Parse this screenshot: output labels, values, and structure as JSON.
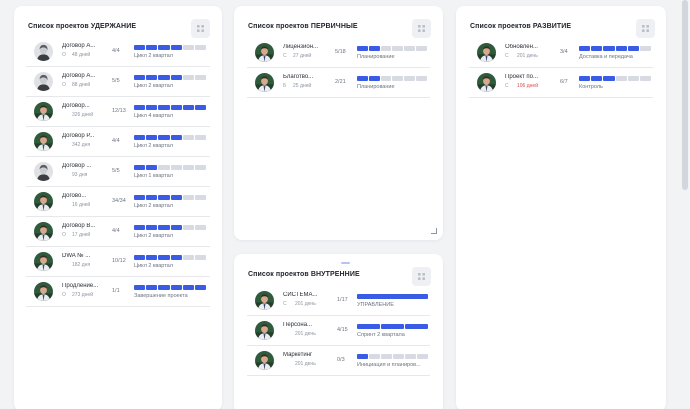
{
  "colors": {
    "accent": "#3a5ce4",
    "segment_off": "#d7dae2",
    "overdue": "#e24a4a"
  },
  "icons": {
    "grip": "grip-icon",
    "avatar": "avatar-photo"
  },
  "cards": [
    {
      "title": "Список проектов УДЕРЖАНИЕ",
      "rows": [
        {
          "name": "Договор А...",
          "code": "О",
          "days": "48 дней",
          "count": "4/4",
          "stage": "Цикл 2 квартал",
          "segments": 6,
          "filled": 4,
          "avatar": "b"
        },
        {
          "name": "Договор А...",
          "code": "О",
          "days": "88 дней",
          "count": "5/5",
          "stage": "Цикл 2 квартал",
          "segments": 6,
          "filled": 4,
          "avatar": "b"
        },
        {
          "name": "Договор...",
          "code": "",
          "days": "326 дней",
          "count": "12/13",
          "stage": "Цикл 4 квартал",
          "segments": 6,
          "filled": 6,
          "avatar": "a"
        },
        {
          "name": "Договор Р...",
          "code": "",
          "days": "342 дня",
          "count": "4/4",
          "stage": "Цикл 2 квартал",
          "segments": 6,
          "filled": 4,
          "avatar": "a"
        },
        {
          "name": "Договор ...",
          "code": "",
          "days": "93 дня",
          "count": "5/5",
          "stage": "Цикл 1 квартал",
          "segments": 6,
          "filled": 2,
          "avatar": "b"
        },
        {
          "name": "Догово...",
          "code": "",
          "days": "16 дней",
          "count": "34/34",
          "stage": "Цикл 2 квартал",
          "segments": 6,
          "filled": 4,
          "avatar": "a"
        },
        {
          "name": "Договор В...",
          "code": "О",
          "days": "17 дней",
          "count": "4/4",
          "stage": "Цикл 2 квартал",
          "segments": 6,
          "filled": 4,
          "avatar": "a"
        },
        {
          "name": "DWA № ...",
          "code": "",
          "days": "182 дня",
          "count": "10/12",
          "stage": "Цикл 2 квартал",
          "segments": 6,
          "filled": 4,
          "avatar": "a"
        },
        {
          "name": "Продление...",
          "code": "О",
          "days": "273 дней",
          "count": "1/1",
          "stage": "Завершение проекта",
          "segments": 6,
          "filled": 6,
          "avatar": "a"
        }
      ]
    },
    {
      "title": "Список проектов ПЕРВИЧНЫЕ",
      "rows": [
        {
          "name": "Лицензион...",
          "code": "С",
          "days": "27 дней",
          "count": "5/18",
          "stage": "Планирование",
          "segments": 6,
          "filled": 2,
          "avatar": "a"
        },
        {
          "name": "Благотво...",
          "code": "Б",
          "days": "25 дней",
          "count": "2/21",
          "stage": "Планирование",
          "segments": 6,
          "filled": 2,
          "avatar": "a"
        }
      ]
    },
    {
      "title": "Список проектов РАЗВИТИЕ",
      "rows": [
        {
          "name": "Обновлен...",
          "code": "С",
          "days": "201 день",
          "count": "3/4",
          "stage": "Доставка и передача",
          "segments": 6,
          "filled": 5,
          "avatar": "a"
        },
        {
          "name": "Проект по...",
          "code": "С",
          "days": "106 дней",
          "count": "6/7",
          "stage": "Контроль",
          "segments": 6,
          "filled": 3,
          "avatar": "a",
          "overdue": true
        }
      ]
    },
    {
      "title": "Список проектов ВНУТРЕННИЕ",
      "rows": [
        {
          "name": "СИСТЕМА...",
          "code": "С",
          "days": "201 день",
          "count": "1/17",
          "stage": "УПРАВЛЕНИЕ",
          "segments": 1,
          "filled": 1,
          "avatar": "a"
        },
        {
          "name": "Персона...",
          "code": "",
          "days": "201 день",
          "count": "4/15",
          "stage": "Спринт 2 квартала",
          "segments": 3,
          "filled": 3,
          "avatar": "a"
        },
        {
          "name": "Маркетинг",
          "code": "",
          "days": "201 день",
          "count": "0/3",
          "stage": "Инициация и планиров...",
          "segments": 6,
          "filled": 1,
          "avatar": "a"
        }
      ]
    }
  ]
}
